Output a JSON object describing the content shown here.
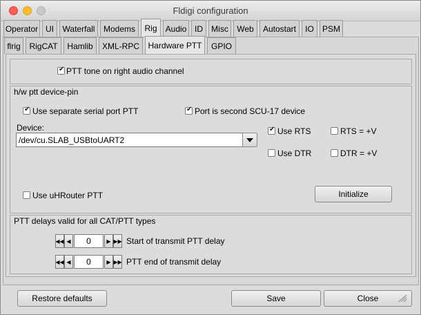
{
  "window": {
    "title": "Fldigi configuration"
  },
  "tabs_top": [
    {
      "label": "Operator"
    },
    {
      "label": "UI"
    },
    {
      "label": "Waterfall"
    },
    {
      "label": "Modems"
    },
    {
      "label": "Rig",
      "active": true
    },
    {
      "label": "Audio"
    },
    {
      "label": "ID"
    },
    {
      "label": "Misc"
    },
    {
      "label": "Web"
    },
    {
      "label": "Autostart"
    },
    {
      "label": "IO"
    },
    {
      "label": "PSM"
    }
  ],
  "tabs_sub": [
    {
      "label": "flrig"
    },
    {
      "label": "RigCAT"
    },
    {
      "label": "Hamlib"
    },
    {
      "label": "XML-RPC"
    },
    {
      "label": "Hardware PTT",
      "active": true
    },
    {
      "label": "GPIO"
    }
  ],
  "ptt_tone": {
    "label": "PTT tone on right audio channel",
    "checked": true
  },
  "hw_group": {
    "title": "h/w ptt device-pin",
    "separate_serial": {
      "label": "Use separate serial port PTT",
      "checked": true
    },
    "second_scu": {
      "label": "Port is second SCU-17 device",
      "checked": true
    },
    "device_label": "Device:",
    "device_value": "/dev/cu.SLAB_USBtoUART2",
    "use_rts": {
      "label": "Use RTS",
      "checked": true
    },
    "rts_plus": {
      "label": "RTS = +V",
      "checked": false
    },
    "use_dtr": {
      "label": "Use DTR",
      "checked": false
    },
    "dtr_plus": {
      "label": "DTR = +V",
      "checked": false
    },
    "uhrouter": {
      "label": "Use uHRouter PTT",
      "checked": false
    },
    "initialize_label": "Initialize"
  },
  "delays_group": {
    "title": "PTT delays valid for all CAT/PTT types",
    "start_delay": {
      "value": "0",
      "label": "Start of transmit PTT delay"
    },
    "end_delay": {
      "value": "0",
      "label": "PTT end of transmit delay"
    }
  },
  "footer": {
    "restore_label": "Restore defaults",
    "save_label": "Save",
    "close_label": "Close"
  },
  "colors": {
    "close": "#fe5f57",
    "minimize": "#febc2e",
    "maximize": "#c9c9c9"
  }
}
